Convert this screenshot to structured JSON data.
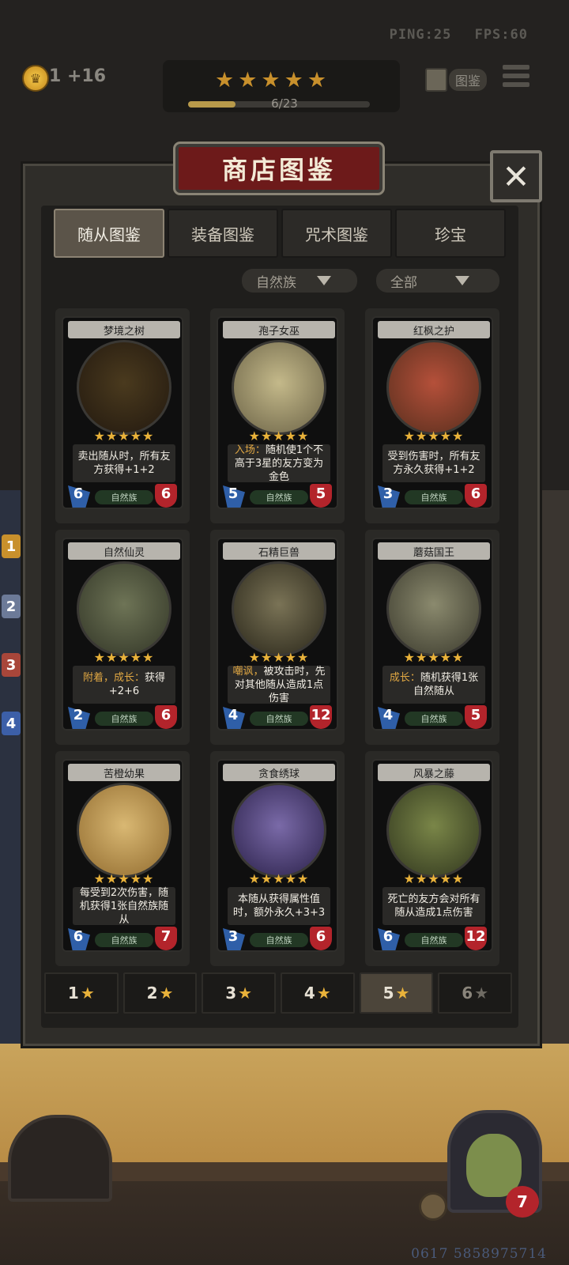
{
  "hud": {
    "ping": "PING:25",
    "fps": "FPS:60",
    "coins": "1 +16",
    "stars": "★★★★★",
    "progress_text": "6/23",
    "progress_value": 0.26,
    "book_label": "图鉴"
  },
  "panel": {
    "title": "商店图鉴",
    "close": "✕",
    "tabs": [
      "随从图鉴",
      "装备图鉴",
      "咒术图鉴",
      "珍宝"
    ],
    "filter_tribe": "自然族",
    "filter_all": "全部"
  },
  "cards": [
    {
      "name": "梦境之树",
      "desc_kw": "",
      "desc": "卖出随从时，所有友方获得+1+2",
      "tribe": "自然族",
      "atk": "6",
      "hp": "6",
      "stars": "★★★★★"
    },
    {
      "name": "孢子女巫",
      "desc_kw": "入场：",
      "desc": "随机使1个不高于3星的友方变为金色",
      "tribe": "自然族",
      "atk": "5",
      "hp": "5",
      "stars": "★★★★★"
    },
    {
      "name": "红枫之护",
      "desc_kw": "",
      "desc": "受到伤害时，所有友方永久获得+1+2",
      "tribe": "自然族",
      "atk": "3",
      "hp": "6",
      "stars": "★★★★★"
    },
    {
      "name": "自然仙灵",
      "desc_kw": "附着，成长：",
      "desc": "获得+2+6",
      "tribe": "自然族",
      "atk": "2",
      "hp": "6",
      "stars": "★★★★★"
    },
    {
      "name": "石精巨兽",
      "desc_kw": "嘲讽，",
      "desc": "被攻击时，先对其他随从造成1点伤害",
      "tribe": "自然族",
      "atk": "4",
      "hp": "12",
      "stars": "★★★★★"
    },
    {
      "name": "蘑菇国王",
      "desc_kw": "成长：",
      "desc": "随机获得1张自然随从",
      "tribe": "自然族",
      "atk": "4",
      "hp": "5",
      "stars": "★★★★★"
    },
    {
      "name": "苦橙幼果",
      "desc_kw": "",
      "desc": "每受到2次伤害，随机获得1张自然族随从",
      "tribe": "自然族",
      "atk": "6",
      "hp": "7",
      "stars": "★★★★★"
    },
    {
      "name": "贪食绣球",
      "desc_kw": "",
      "desc": "本随从获得属性值时，额外永久+3+3",
      "tribe": "自然族",
      "atk": "3",
      "hp": "6",
      "stars": "★★★★★"
    },
    {
      "name": "风暴之藤",
      "desc_kw": "",
      "desc": "死亡的友方会对所有随从造成1点伤害",
      "tribe": "自然族",
      "atk": "6",
      "hp": "12",
      "stars": "★★★★★"
    }
  ],
  "star_filters": [
    "1",
    "2",
    "3",
    "4",
    "5",
    "6"
  ],
  "star_filter_active": "5",
  "side_tags": [
    "1",
    "2",
    "3",
    "4"
  ],
  "player": {
    "health": "7",
    "uid": "0617 5858975714"
  },
  "colors": {
    "accent_gold": "#e9b23a",
    "banner_red": "#6d1a1a",
    "attack_blue": "#2f5fa8",
    "health_red": "#b3242b"
  }
}
